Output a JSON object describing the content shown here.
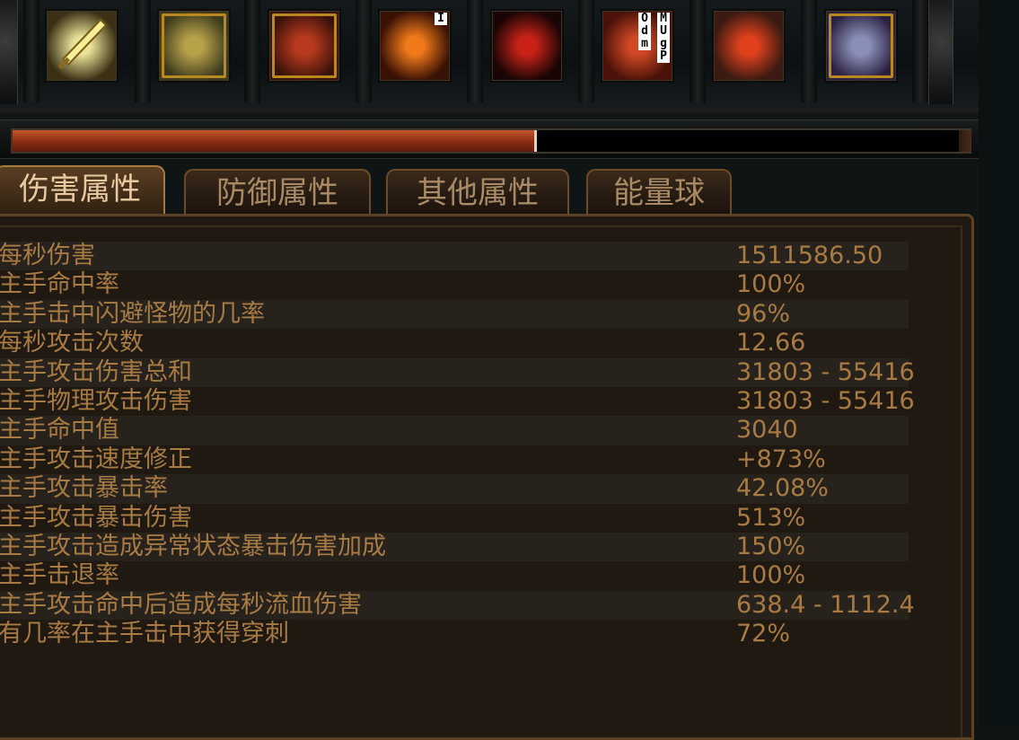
{
  "skillbar": {
    "slots": [
      {
        "name": "sword-skill-icon",
        "colors": [
          "#e9e39a",
          "#3b3014"
        ]
      },
      {
        "name": "golden-figure-skill-icon",
        "colors": [
          "#b7a24a",
          "#3d3a1c"
        ]
      },
      {
        "name": "red-warrior-skill-icon",
        "colors": [
          "#b83a1e",
          "#3a120a"
        ]
      },
      {
        "name": "fire-burst-skill-icon",
        "colors": [
          "#f07a1a",
          "#3a1105"
        ],
        "badge": "I"
      },
      {
        "name": "blood-figure-skill-icon",
        "colors": [
          "#c82218",
          "#1a0505"
        ]
      },
      {
        "name": "flame-wave-skill-icon",
        "colors": [
          "#d04826",
          "#4a1208"
        ],
        "badge_chars": [
          "O",
          "d",
          "m"
        ],
        "badge2_chars": [
          "M",
          "U",
          "g",
          "P"
        ]
      },
      {
        "name": "molten-eye-skill-icon",
        "colors": [
          "#e0411c",
          "#3a1a12"
        ]
      },
      {
        "name": "armored-knight-skill-icon",
        "colors": [
          "#8a8fb7",
          "#2a2040"
        ]
      }
    ]
  },
  "xp_bar": {
    "fill_fraction": 0.545
  },
  "tabs": [
    {
      "label": "伤害属性",
      "active": true
    },
    {
      "label": "防御属性",
      "active": false
    },
    {
      "label": "其他属性",
      "active": false
    },
    {
      "label": "能量球",
      "active": false
    }
  ],
  "stats": [
    {
      "label": "每秒伤害",
      "value": "1511586.50"
    },
    {
      "label": "主手命中率",
      "value": "100%"
    },
    {
      "label": "主手击中闪避怪物的几率",
      "value": "96%"
    },
    {
      "label": "每秒攻击次数",
      "value": "12.66"
    },
    {
      "label": "主手攻击伤害总和",
      "value": "31803 - 55416"
    },
    {
      "label": "主手物理攻击伤害",
      "value": "31803 - 55416"
    },
    {
      "label": "主手命中值",
      "value": "3040"
    },
    {
      "label": "主手攻击速度修正",
      "value": "+873%"
    },
    {
      "label": "主手攻击暴击率",
      "value": "42.08%"
    },
    {
      "label": "主手攻击暴击伤害",
      "value": "513%"
    },
    {
      "label": "主手攻击造成异常状态暴击伤害加成",
      "value": "150%"
    },
    {
      "label": "主手击退率",
      "value": "100%"
    },
    {
      "label": "主手攻击命中后造成每秒流血伤害",
      "value": "638.4 - 1112.4"
    },
    {
      "label": "有几率在主手击中获得穿刺",
      "value": "72%"
    }
  ]
}
